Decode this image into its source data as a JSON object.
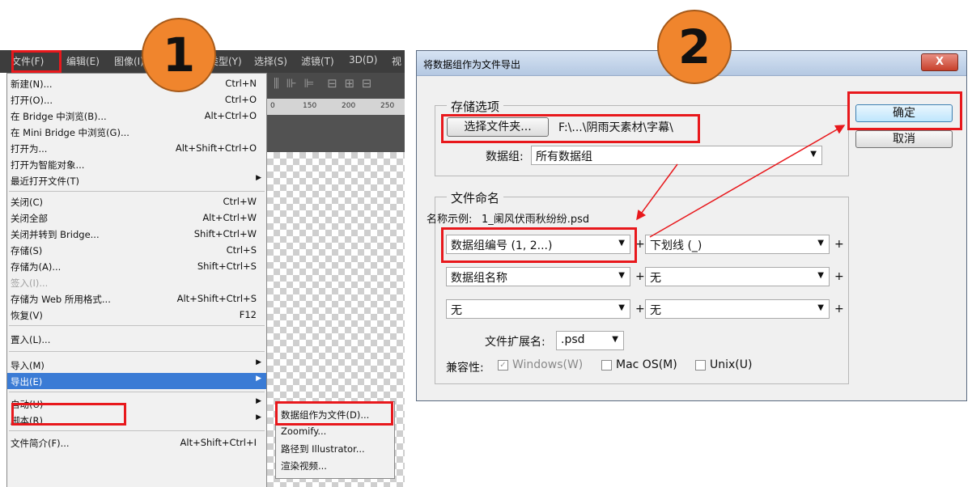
{
  "left_menu": {
    "menubar": [
      "文件(F)",
      "编辑(E)",
      "图像(I)",
      "类型(Y)",
      "选择(S)",
      "滤镜(T)",
      "3D(D)",
      "视"
    ],
    "ruler_ticks": [
      "0",
      "150",
      "200",
      "250"
    ],
    "items": [
      {
        "label": "新建(N)...",
        "shortcut": "Ctrl+N"
      },
      {
        "label": "打开(O)...",
        "shortcut": "Ctrl+O"
      },
      {
        "label": "在 Bridge 中浏览(B)...",
        "shortcut": "Alt+Ctrl+O"
      },
      {
        "label": "在 Mini Bridge 中浏览(G)...",
        "shortcut": ""
      },
      {
        "label": "打开为...",
        "shortcut": "Alt+Shift+Ctrl+O"
      },
      {
        "label": "打开为智能对象...",
        "shortcut": ""
      },
      {
        "label": "最近打开文件(T)",
        "shortcut": ""
      },
      {
        "label": "关闭(C)",
        "shortcut": "Ctrl+W"
      },
      {
        "label": "关闭全部",
        "shortcut": "Alt+Ctrl+W"
      },
      {
        "label": "关闭并转到 Bridge...",
        "shortcut": "Shift+Ctrl+W"
      },
      {
        "label": "存储(S)",
        "shortcut": "Ctrl+S"
      },
      {
        "label": "存储为(A)...",
        "shortcut": "Shift+Ctrl+S"
      },
      {
        "label": "签入(I)...",
        "shortcut": ""
      },
      {
        "label": "存储为 Web 所用格式...",
        "shortcut": "Alt+Shift+Ctrl+S"
      },
      {
        "label": "恢复(V)",
        "shortcut": "F12"
      },
      {
        "label": "置入(L)...",
        "shortcut": ""
      },
      {
        "label": "导入(M)",
        "shortcut": ""
      },
      {
        "label": "导出(E)",
        "shortcut": ""
      },
      {
        "label": "自动(U)",
        "shortcut": ""
      },
      {
        "label": "脚本(R)",
        "shortcut": ""
      },
      {
        "label": "文件简介(F)...",
        "shortcut": "Alt+Shift+Ctrl+I"
      }
    ],
    "submenu": [
      "数据组作为文件(D)...",
      "Zoomify...",
      "路径到 Illustrator...",
      "渲染视频..."
    ]
  },
  "badges": {
    "one": "1",
    "two": "2"
  },
  "dialog": {
    "title": "将数据组作为文件导出",
    "close": "X",
    "ok": "确定",
    "cancel": "取消",
    "storage": {
      "legend": "存储选项",
      "choose_folder": "选择文件夹...",
      "path": "F:\\...\\阴雨天素材\\字幕\\",
      "dataset_label": "数据组:",
      "dataset_value": "所有数据组"
    },
    "naming": {
      "legend": "文件命名",
      "example_label": "名称示例:",
      "example": "1_阑风伏雨秋纷纷.psd",
      "rows": [
        [
          "数据组编号 (1, 2...)",
          "下划线 (_)"
        ],
        [
          "数据组名称",
          "无"
        ],
        [
          "无",
          "无"
        ]
      ],
      "plus": "+",
      "ext_label": "文件扩展名:",
      "ext_value": ".psd",
      "compat_label": "兼容性:",
      "windows": "Windows(W)",
      "mac": "Mac OS(M)",
      "unix": "Unix(U)"
    }
  }
}
